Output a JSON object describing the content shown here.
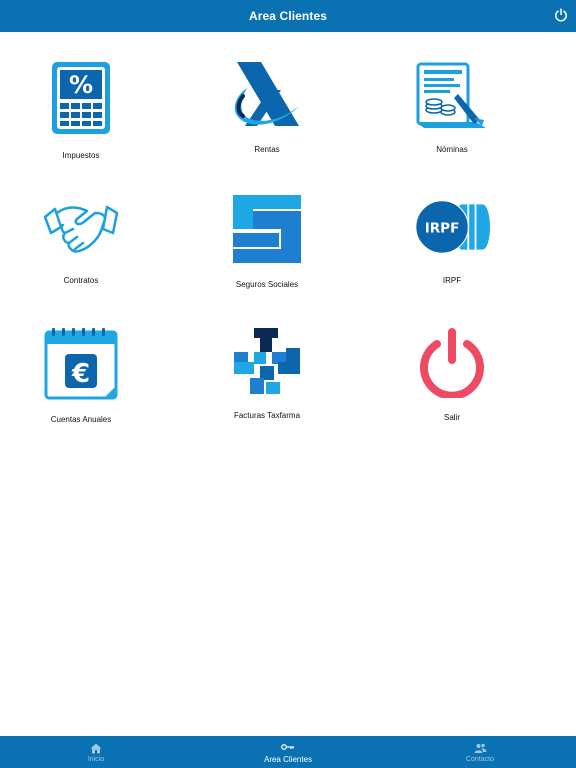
{
  "header": {
    "title": "Area Clientes",
    "power_icon": "power-icon"
  },
  "tiles": [
    {
      "label": "Impuestos",
      "icon": "calculator-percent-icon"
    },
    {
      "label": "Rentas",
      "icon": "agencia-tributaria-icon"
    },
    {
      "label": "Nóminas",
      "icon": "payslip-coins-icon"
    },
    {
      "label": "Contratos",
      "icon": "handshake-icon"
    },
    {
      "label": "Seguros Sociales",
      "icon": "seguridad-social-icon"
    },
    {
      "label": "IRPF",
      "icon": "irpf-coins-icon"
    },
    {
      "label": "Cuentas Anuales",
      "icon": "euro-calendar-icon"
    },
    {
      "label": "Facturas Taxfarma",
      "icon": "taxfarma-logo-icon"
    },
    {
      "label": "Salir",
      "icon": "power-icon"
    }
  ],
  "tabbar": [
    {
      "label": "Inicio",
      "icon": "home-icon",
      "active": false
    },
    {
      "label": "Area Clientes",
      "icon": "key-icon",
      "active": true
    },
    {
      "label": "Contacto",
      "icon": "contacts-icon",
      "active": false
    }
  ],
  "colors": {
    "primary": "#0a72b3",
    "accent": "#1e9fe0",
    "salir": "#ef4a63"
  },
  "irpf_icon_text": "IRPF"
}
